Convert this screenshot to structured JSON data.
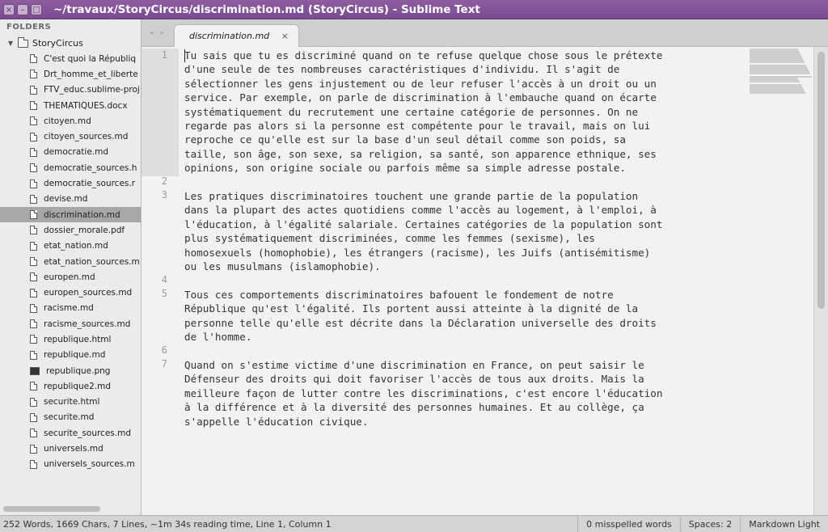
{
  "window": {
    "title": "~/travaux/StoryCircus/discrimination.md (StoryCircus) - Sublime Text",
    "controls": [
      "×",
      "–",
      "□"
    ]
  },
  "sidebar": {
    "header": "FOLDERS",
    "project": "StoryCircus",
    "files": [
      {
        "label": "C'est quoi la Républiq",
        "icon": "file-icon"
      },
      {
        "label": "Drt_homme_et_liberte",
        "icon": "file-icon"
      },
      {
        "label": "FTV_educ.sublime-proj",
        "icon": "file-icon"
      },
      {
        "label": "THEMATIQUES.docx",
        "icon": "file-icon"
      },
      {
        "label": "citoyen.md",
        "icon": "file-icon"
      },
      {
        "label": "citoyen_sources.md",
        "icon": "file-icon"
      },
      {
        "label": "democratie.md",
        "icon": "file-icon"
      },
      {
        "label": "democratie_sources.h",
        "icon": "file-icon"
      },
      {
        "label": "democratie_sources.r",
        "icon": "file-icon"
      },
      {
        "label": "devise.md",
        "icon": "file-icon"
      },
      {
        "label": "discrimination.md",
        "icon": "file-icon",
        "selected": true
      },
      {
        "label": "dossier_morale.pdf",
        "icon": "file-icon"
      },
      {
        "label": "etat_nation.md",
        "icon": "file-icon"
      },
      {
        "label": "etat_nation_sources.m",
        "icon": "file-icon"
      },
      {
        "label": "europen.md",
        "icon": "file-icon"
      },
      {
        "label": "europen_sources.md",
        "icon": "file-icon"
      },
      {
        "label": "racisme.md",
        "icon": "file-icon"
      },
      {
        "label": "racisme_sources.md",
        "icon": "file-icon"
      },
      {
        "label": "republique.html",
        "icon": "file-icon"
      },
      {
        "label": "republique.md",
        "icon": "file-icon"
      },
      {
        "label": "republique.png",
        "icon": "image-file-icon"
      },
      {
        "label": "republique2.md",
        "icon": "file-icon"
      },
      {
        "label": "securite.html",
        "icon": "file-icon"
      },
      {
        "label": "securite.md",
        "icon": "file-icon"
      },
      {
        "label": "securite_sources.md",
        "icon": "file-icon"
      },
      {
        "label": "universels.md",
        "icon": "file-icon"
      },
      {
        "label": "universels_sources.m",
        "icon": "file-icon"
      }
    ]
  },
  "tabs": [
    {
      "label": "discrimination.md",
      "close": "×",
      "active": true
    }
  ],
  "editor": {
    "line_numbers": [
      "1",
      "2",
      "3",
      "4",
      "5",
      "6",
      "7"
    ],
    "paragraphs": [
      "Tu sais que tu es discriminé quand on te refuse quelque chose sous le prétexte\nd'une seule de tes nombreuses caractéristiques d'individu. Il s'agit de\nsélectionner les gens injustement ou de leur refuser l'accès à un droit ou un\nservice. Par exemple, on parle de discrimination à l'embauche quand on écarte\nsystématiquement du recrutement une certaine catégorie de personnes. On ne\nregarde pas alors si la personne est compétente pour le travail, mais on lui\nreproche ce qu'elle est sur la base d'un seul détail comme son poids, sa\ntaille, son âge, son sexe, sa religion, sa santé, son apparence ethnique, ses\nopinions, son origine sociale ou parfois même sa simple adresse postale.",
      "Les pratiques discriminatoires touchent une grande partie de la population\ndans la plupart des actes quotidiens comme l'accès au logement, à l'emploi, à\nl'éducation, à l'égalité salariale. Certaines catégories de la population sont\nplus systématiquement discriminées, comme les femmes (sexisme), les\nhomosexuels (homophobie), les étrangers (racisme), les Juifs (antisémitisme)\nou les musulmans (islamophobie).",
      "Tous ces comportements discriminatoires bafouent le fondement de notre\nRépublique qu'est l'égalité. Ils portent aussi atteinte à la dignité de la\npersonne telle qu'elle est décrite dans la Déclaration universelle des droits\nde l'homme.",
      "Quand on s'estime victime d'une discrimination en France, on peut saisir le\nDéfenseur des droits qui doit favoriser l'accès de tous aux droits. Mais la\nmeilleure façon de lutter contre les discriminations, c'est encore l'éducation\nà la différence et à la diversité des personnes humaines. Et au collège, ça\ns'appelle l'éducation civique."
    ]
  },
  "statusbar": {
    "info": "252 Words, 1669 Chars, 7 Lines, ~1m 34s reading time, Line 1, Column 1",
    "spelling": "0 misspelled words",
    "spaces": "Spaces: 2",
    "syntax": "Markdown Light"
  },
  "colors": {
    "titlebar": "#7a4c8f",
    "editor_bg": "#f2f2f2",
    "sidebar_selected": "#a7a7a7"
  }
}
